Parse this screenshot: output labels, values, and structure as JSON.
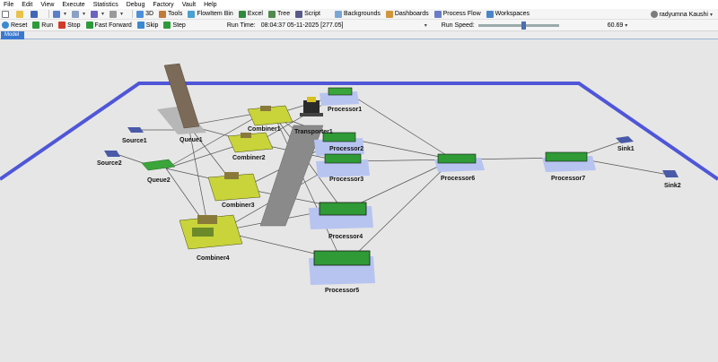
{
  "menu": [
    "File",
    "Edit",
    "View",
    "Execute",
    "Statistics",
    "Debug",
    "Factory",
    "Vault",
    "Help"
  ],
  "toolbar": {
    "btn_3d": "3D",
    "btn_tools": "Tools",
    "btn_flowitem": "FlowItem Bin",
    "btn_excel": "Excel",
    "btn_tree": "Tree",
    "btn_script": "Script",
    "btn_backgrounds": "Backgrounds",
    "btn_dashboards": "Dashboards",
    "btn_processflow": "Process Flow",
    "btn_workspaces": "Workspaces",
    "user": "radyumna Kaushi"
  },
  "runbar": {
    "reset": "Reset",
    "run": "Run",
    "stop": "Stop",
    "fast_forward": "Fast Forward",
    "skip": "Skip",
    "step": "Step",
    "run_time_label": "Run Time:",
    "run_time_value": "08:04:37  05-11-2025  [277.05]",
    "run_speed_label": "Run Speed:",
    "run_speed_value": "60.69"
  },
  "tab": {
    "label": "Model"
  },
  "model": {
    "source1": "Source1",
    "source2": "Source2",
    "queue1": "Queue1",
    "queue2": "Queue2",
    "combiner1": "Combiner1",
    "combiner2": "Combiner2",
    "combiner3": "Combiner3",
    "combiner4": "Combiner4",
    "transporter": "Transporter1",
    "processor1": "Processor1",
    "processor2": "Processor2",
    "processor3": "Processor3",
    "processor4": "Processor4",
    "processor5": "Processor5",
    "processor6": "Processor6",
    "processor7": "Processor7",
    "sink1": "Sink1",
    "sink2": "Sink2"
  },
  "colors": {
    "floor_border": "#4f56d8",
    "tab_bg": "#3a78d0",
    "combiner_fill": "#c8d43a",
    "queue_fill": "#3aa53a",
    "processor_shadow": "#b8c4f0"
  }
}
